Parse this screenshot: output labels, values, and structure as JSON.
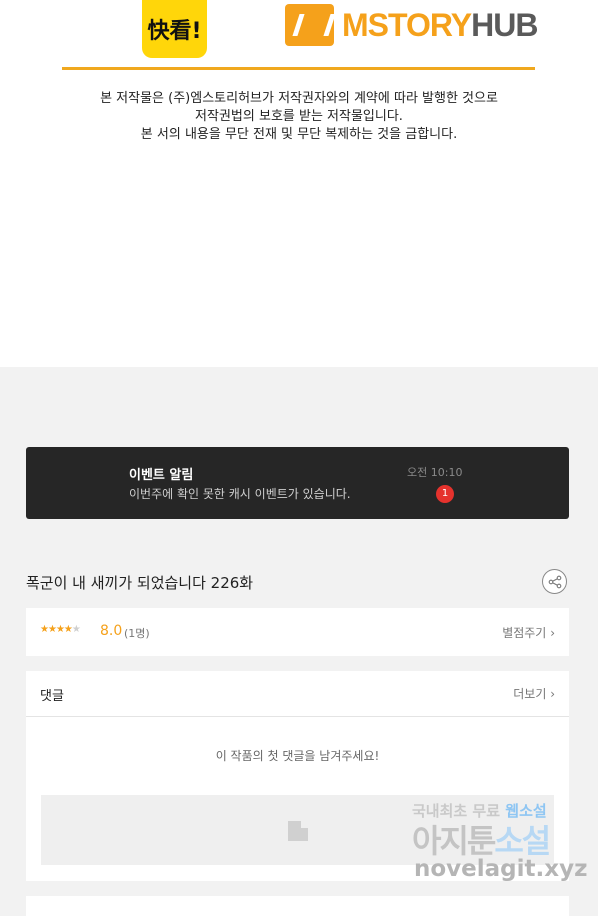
{
  "header": {
    "kuaikan_logo": "快看!",
    "mstory_logo_part1": "MSTORY",
    "mstory_logo_part2": "HUB",
    "notice_lines": [
      "본 저작물은 (주)엠스토리허브가 저작권자와의 계약에 따라 발행한 것으로",
      "저작권법의 보호를 받는 저작물입니다.",
      "본 서의 내용을 무단 전재 및 무단 복제하는 것을 금합니다."
    ]
  },
  "event": {
    "title": "이벤트 알림",
    "description": "이번주에 확인 못한 캐시 이벤트가 있습니다.",
    "time": "오전 10:10",
    "badge": "1"
  },
  "episode": {
    "title": "폭군이 내 새끼가 되었습니다 226화",
    "share_icon": "share-icon"
  },
  "rating": {
    "stars_filled": 4,
    "stars_total": 5,
    "score": "8.0",
    "count": "(1명)",
    "rate_link": "별점주기"
  },
  "comments": {
    "label": "댓글",
    "more": "더보기",
    "empty_message": "이 작품의 첫 댓글을 남겨주세요!"
  },
  "watermark": {
    "line1_a": "국내최초 무료",
    "line1_b": "웹소설",
    "line2_a": "아지툰",
    "line2_b": "소설",
    "line3": "novelagit.xyz"
  },
  "colors": {
    "accent": "#f5a11b",
    "badge": "#e5322d",
    "kuaikan_yellow": "#ffd60a",
    "event_bg": "#262626"
  }
}
